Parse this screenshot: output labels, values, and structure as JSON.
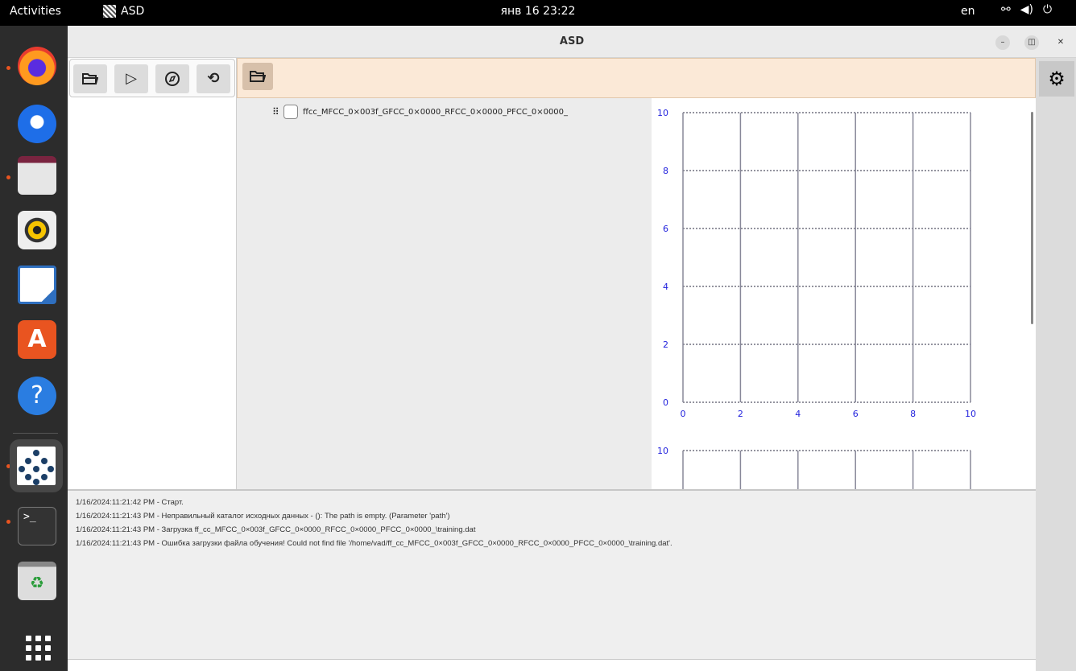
{
  "topbar": {
    "activities": "Activities",
    "app_name": "ASD",
    "clock": "янв 16  23:22",
    "lang": "en",
    "tray_icons": [
      "network-icon",
      "volume-icon",
      "power-icon"
    ]
  },
  "dock": {
    "items": [
      "firefox",
      "thunderbird",
      "files",
      "rhythmbox",
      "libreoffice-writer",
      "app-center",
      "help",
      "asd",
      "terminal",
      "trash",
      "show-apps"
    ]
  },
  "window": {
    "title": "ASD",
    "buttons": [
      "minimize",
      "restore",
      "close"
    ]
  },
  "toolbar": {
    "open_icon": "folder-open-icon",
    "run_icon": "play-icon",
    "navigate_icon": "compass-icon",
    "refresh_icon": "refresh-icon"
  },
  "centerbar": {
    "open_icon": "folder-open-icon"
  },
  "files": [
    {
      "name": "ffcc_MFCC_0×003f_GFCC_0×0000_RFCC_0×0000_PFCC_0×0000_",
      "checked": false
    }
  ],
  "log": [
    "1/16/2024:11:21:42 PM - Старт.",
    "1/16/2024:11:21:43 PM - Неправильный каталог исходных данных - (): The path is empty. (Parameter 'path')",
    "1/16/2024:11:21:43 PM - Загрузка ff_cc_MFCC_0×003f_GFCC_0×0000_RFCC_0×0000_PFCC_0×0000_\\training.dat",
    "1/16/2024:11:21:43 PM - Ошибка загрузки файла обучения! Could not find file '/home/vad/ff_cc_MFCC_0×003f_GFCC_0×0000_RFCC_0×0000_PFCC_0×0000_\\training.dat'."
  ],
  "chart_data": [
    {
      "type": "line",
      "series": [],
      "xlim": [
        0,
        10
      ],
      "ylim": [
        0,
        10
      ],
      "x_ticks": [
        "0",
        "2",
        "4",
        "6",
        "8",
        "10"
      ],
      "y_ticks": [
        "0",
        "2",
        "4",
        "6",
        "8",
        "10"
      ],
      "grid": true,
      "tick_color": "#2222dd"
    },
    {
      "type": "line",
      "series": [],
      "ylim_top_label": "10",
      "grid": true
    }
  ]
}
